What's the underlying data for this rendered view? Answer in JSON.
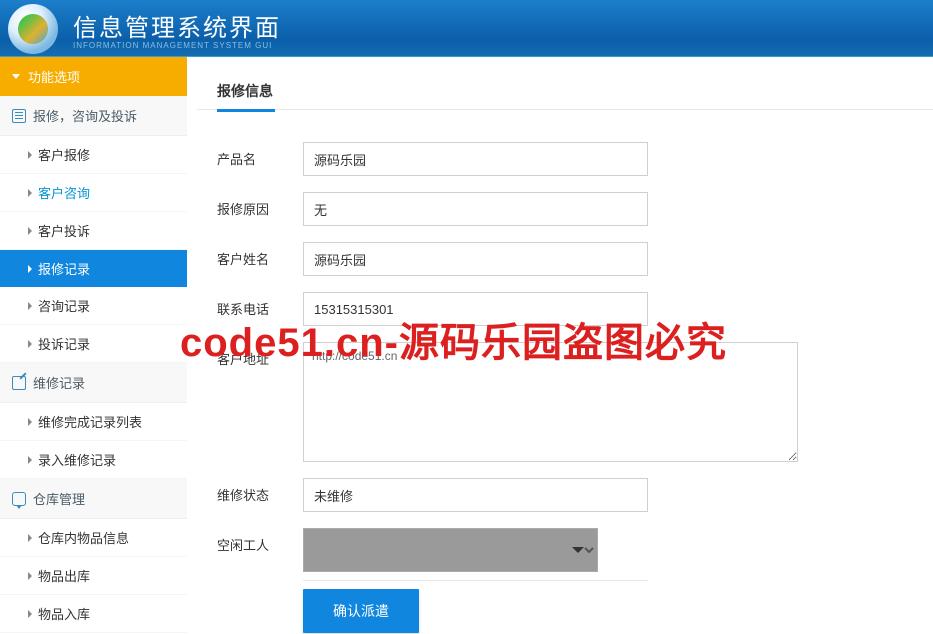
{
  "header": {
    "title": "信息管理系统界面",
    "subtitle": "INFORMATION MANAGEMENT SYSTEM GUI"
  },
  "sidebar": {
    "func_section": "功能选项",
    "sections": [
      {
        "label": "报修，咨询及投诉",
        "items": [
          {
            "label": "客户报修",
            "state": "normal"
          },
          {
            "label": "客户咨询",
            "state": "highlight"
          },
          {
            "label": "客户投诉",
            "state": "normal"
          },
          {
            "label": "报修记录",
            "state": "active"
          },
          {
            "label": "咨询记录",
            "state": "normal"
          },
          {
            "label": "投诉记录",
            "state": "normal"
          }
        ]
      },
      {
        "label": "维修记录",
        "items": [
          {
            "label": "维修完成记录列表",
            "state": "normal"
          },
          {
            "label": "录入维修记录",
            "state": "normal"
          }
        ]
      },
      {
        "label": "仓库管理",
        "items": [
          {
            "label": "仓库内物品信息",
            "state": "normal"
          },
          {
            "label": "物品出库",
            "state": "normal"
          },
          {
            "label": "物品入库",
            "state": "normal"
          }
        ]
      }
    ]
  },
  "main": {
    "tab_title": "报修信息",
    "fields": {
      "product_name_label": "产品名",
      "product_name_value": "源码乐园",
      "reason_label": "报修原因",
      "reason_value": "无",
      "customer_label": "客户姓名",
      "customer_value": "源码乐园",
      "phone_label": "联系电话",
      "phone_value": "15315315301",
      "address_label": "客户地址",
      "address_value": "http://code51.cn",
      "status_label": "维修状态",
      "status_value": "未维修",
      "worker_label": "空闲工人",
      "worker_value": "",
      "submit_label": "确认派遣"
    }
  },
  "watermark": "code51.cn-源码乐园盗图必究"
}
